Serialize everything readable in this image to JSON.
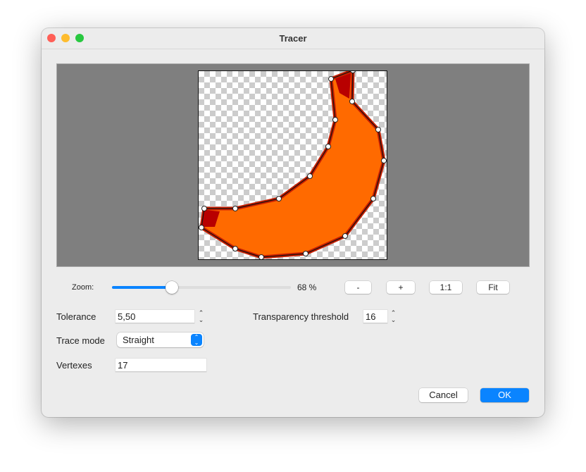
{
  "window": {
    "title": "Tracer"
  },
  "zoom": {
    "label": "Zoom:",
    "value_text": "68 %",
    "slider_fraction": 0.34,
    "buttons": {
      "minus": "-",
      "plus": "+",
      "one_to_one": "1:1",
      "fit": "Fit"
    }
  },
  "tolerance": {
    "label": "Tolerance",
    "value": "5,50"
  },
  "transparency": {
    "label": "Transparency threshold",
    "value": "16"
  },
  "trace_mode": {
    "label": "Trace mode",
    "value": "Straight"
  },
  "vertexes": {
    "label": "Vertexes",
    "value": "17"
  },
  "actions": {
    "cancel": "Cancel",
    "ok": "OK"
  },
  "colors": {
    "accent": "#0a84ff",
    "close": "#ff5f57",
    "minimize": "#febc2e",
    "zoom": "#28c840"
  }
}
